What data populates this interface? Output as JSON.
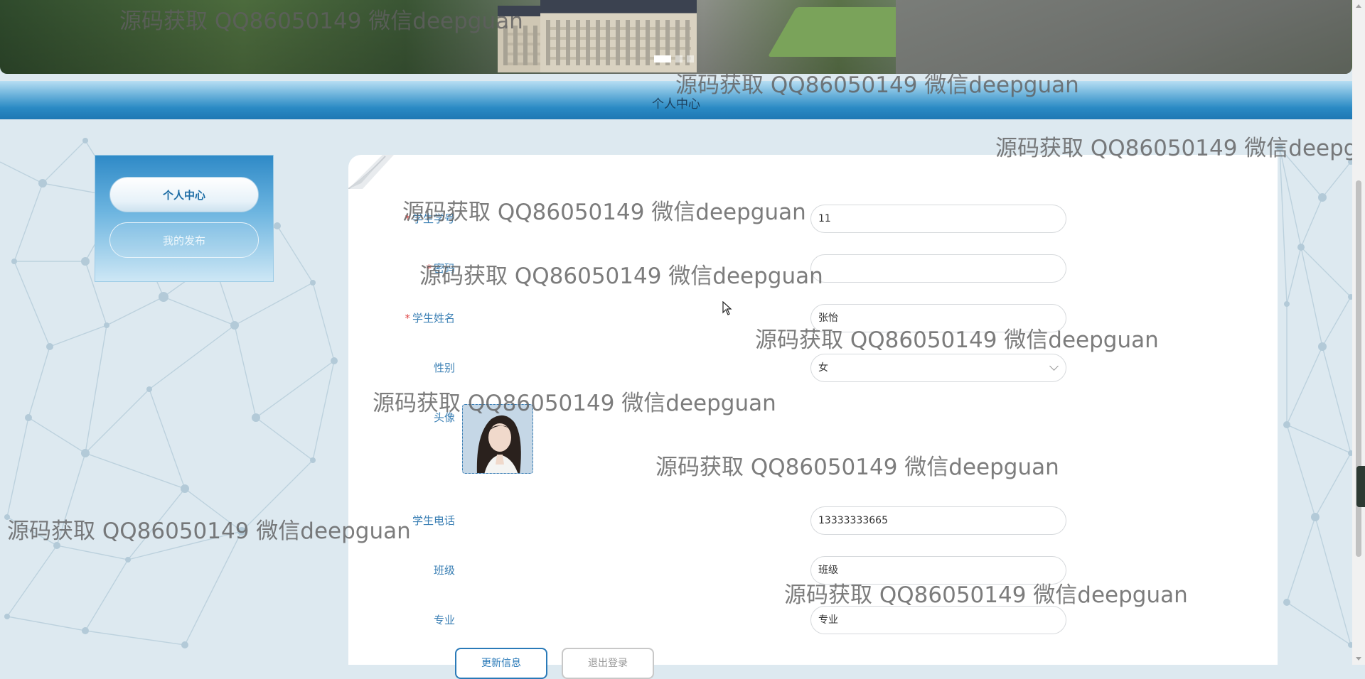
{
  "banner": {
    "carousel_dots": [
      {
        "active": true
      },
      {
        "active": false
      },
      {
        "active": false
      }
    ]
  },
  "header": {
    "title": "个人中心"
  },
  "sidebar": {
    "items": [
      {
        "label": "个人中心",
        "active": true
      },
      {
        "label": "我的发布",
        "active": false
      }
    ]
  },
  "form": {
    "student_id": {
      "label": "学生学号",
      "required": true,
      "value": "11"
    },
    "password": {
      "label": "密码",
      "required": true,
      "value": ""
    },
    "student_name": {
      "label": "学生姓名",
      "required": true,
      "value": "张怡"
    },
    "gender": {
      "label": "性别",
      "value": "女"
    },
    "avatar": {
      "label": "头像"
    },
    "phone": {
      "label": "学生电话",
      "value": "13333333665"
    },
    "class": {
      "label": "班级",
      "value": "班级"
    },
    "major": {
      "label": "专业",
      "value": "专业"
    },
    "update_button": "更新信息",
    "logout_button": "退出登录"
  },
  "watermark": {
    "text": "源码获取 QQ86050149 微信deepguan"
  },
  "colors": {
    "accent": "#2a7ab8",
    "label": "#3a7fb4",
    "required": "#e04a4a",
    "titlebar": "#1f78b4"
  }
}
